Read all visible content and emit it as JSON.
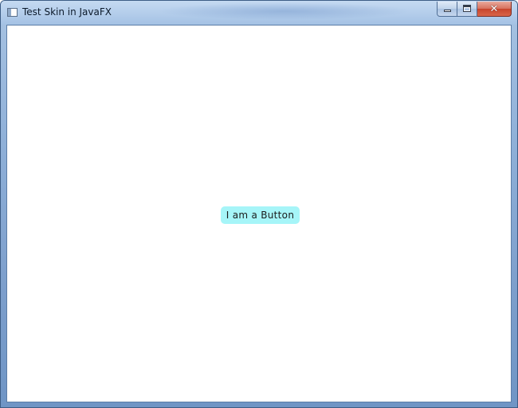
{
  "window": {
    "title": "Test Skin in JavaFX",
    "app_icon": "window-app-icon",
    "caption_buttons": {
      "minimize_icon": "minimize-icon",
      "maximize_icon": "maximize-icon",
      "close_icon": "close-icon",
      "close_glyph": "✕"
    }
  },
  "content": {
    "button_label": "I am a Button",
    "button_color": "#a6f5f8",
    "background_color": "#ffffff"
  }
}
